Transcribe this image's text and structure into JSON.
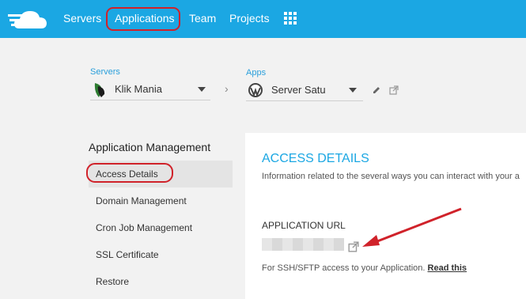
{
  "nav": {
    "items": [
      "Servers",
      "Applications",
      "Team",
      "Projects"
    ],
    "active": "Applications",
    "grid_icon": "apps-grid-icon"
  },
  "breadcrumb": {
    "servers_label": "Servers",
    "server_value": "Klik Mania",
    "apps_label": "Apps",
    "app_value": "Server Satu"
  },
  "sidebar": {
    "title": "Application Management",
    "items": [
      {
        "label": "Access Details",
        "active": true
      },
      {
        "label": "Domain Management"
      },
      {
        "label": "Cron Job Management"
      },
      {
        "label": "SSL Certificate"
      },
      {
        "label": "Restore"
      }
    ]
  },
  "panel": {
    "title": "ACCESS DETAILS",
    "description": "Information related to the several ways you can interact with your a",
    "url_heading": "APPLICATION URL",
    "ssh_text": "For SSH/SFTP access to your Application.",
    "ssh_link": "Read this"
  },
  "colors": {
    "brand": "#1ba7e3",
    "highlight": "#d0222a"
  }
}
